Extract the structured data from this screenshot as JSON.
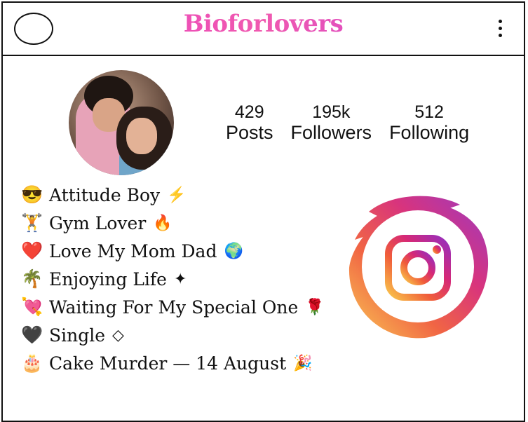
{
  "header": {
    "brand": "Bioforlovers"
  },
  "profile": {
    "stats": [
      {
        "number": "429",
        "label": "Posts"
      },
      {
        "number": "195k",
        "label": "Followers"
      },
      {
        "number": "512",
        "label": "Following"
      }
    ]
  },
  "bio": [
    {
      "emoji": "😎",
      "text": "Attitude Boy",
      "tail": "⚡"
    },
    {
      "emoji": "🏋",
      "text": "Gym Lover",
      "tail": "🔥"
    },
    {
      "emoji": "❤️",
      "text": "Love My Mom Dad",
      "tail": "🌍"
    },
    {
      "emoji": "🌴",
      "text": "Enjoying Life",
      "tail": "✦"
    },
    {
      "emoji": "💘",
      "text": "Waiting For My Special One",
      "tail": "🌹"
    },
    {
      "emoji": "🖤",
      "text": "Single",
      "tail": "◇"
    },
    {
      "emoji": "🎂",
      "text": "Cake Murder — 14 August",
      "tail": "🎉"
    }
  ],
  "icons": {
    "top_left": "circle-placeholder-icon",
    "menu": "more-vertical-icon",
    "logo": "instagram-logo-icon"
  },
  "colors": {
    "brand_gradient": [
      "#e93cc5",
      "#c63ad7"
    ],
    "instagram_gradient": [
      "#f9c54b",
      "#f05d3a",
      "#d62976",
      "#962fbf"
    ]
  }
}
